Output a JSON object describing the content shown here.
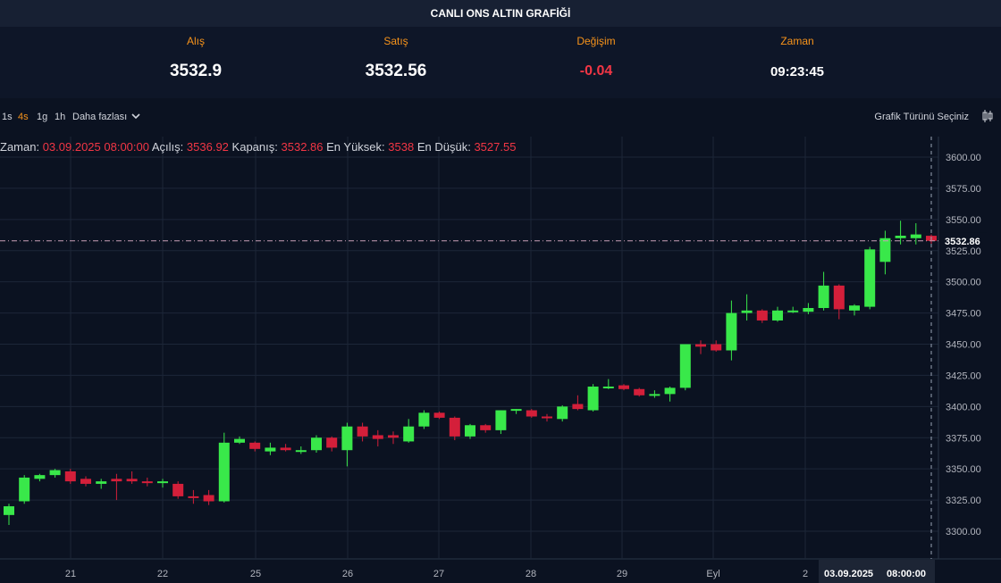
{
  "header": {
    "title": "CANLI ONS ALTIN GRAFİĞİ"
  },
  "quotes": {
    "bid_label": "Alış",
    "bid": "3532.9",
    "ask_label": "Satış",
    "ask": "3532.56",
    "change_label": "Değişim",
    "change": "-0.04",
    "time_label": "Zaman",
    "time": "09:23:45"
  },
  "toolbar": {
    "timeframes": [
      "1s",
      "4s",
      "1g",
      "1h"
    ],
    "active_timeframe": "4s",
    "more_label": "Daha fazlası",
    "chart_type_label": "Grafik Türünü Seçiniz"
  },
  "ohlc_legend": {
    "time_label": "Zaman:",
    "time": "03.09.2025 08:00:00",
    "open_label": "Açılış:",
    "open": "3536.92",
    "close_label": "Kapanış:",
    "close": "3532.86",
    "high_label": "En Yüksek:",
    "high": "3538",
    "low_label": "En Düşük:",
    "low": "3527.55"
  },
  "colors": {
    "up": "#39e84a",
    "down": "#d41f3a",
    "background": "#0b1221",
    "grid": "#1c2638",
    "accent": "#f7931a"
  },
  "chart_data": {
    "type": "candlestick",
    "ylim": [
      3275,
      3615
    ],
    "y_ticks": [
      3300,
      3325,
      3350,
      3375,
      3400,
      3425,
      3450,
      3475,
      3500,
      3525,
      3550,
      3575,
      3600
    ],
    "y_tick_labels": [
      "3300.00",
      "3325.00",
      "3350.00",
      "3375.00",
      "3400.00",
      "3425.00",
      "3450.00",
      "3475.00",
      "3500.00",
      "3525.00",
      "3550.00",
      "3575.00",
      "3600.00"
    ],
    "x_labels": [
      "21",
      "22",
      "25",
      "26",
      "27",
      "28",
      "29",
      "Eyl",
      "2"
    ],
    "last_price_label": "3532.86",
    "crosshair_date": "03.09.2025",
    "crosshair_time": "08:00:00",
    "candles": [
      {
        "o": 3313,
        "h": 3322,
        "l": 3305,
        "c": 3320
      },
      {
        "o": 3324,
        "h": 3345,
        "l": 3322,
        "c": 3343
      },
      {
        "o": 3342,
        "h": 3346,
        "l": 3340,
        "c": 3345
      },
      {
        "o": 3345,
        "h": 3350,
        "l": 3343,
        "c": 3349
      },
      {
        "o": 3348,
        "h": 3350,
        "l": 3338,
        "c": 3340
      },
      {
        "o": 3342,
        "h": 3344,
        "l": 3336,
        "c": 3338
      },
      {
        "o": 3338,
        "h": 3342,
        "l": 3334,
        "c": 3340
      },
      {
        "o": 3342,
        "h": 3346,
        "l": 3325,
        "c": 3340
      },
      {
        "o": 3342,
        "h": 3348,
        "l": 3338,
        "c": 3340
      },
      {
        "o": 3340,
        "h": 3343,
        "l": 3336,
        "c": 3339
      },
      {
        "o": 3339,
        "h": 3342,
        "l": 3335,
        "c": 3340
      },
      {
        "o": 3338,
        "h": 3340,
        "l": 3326,
        "c": 3328
      },
      {
        "o": 3328,
        "h": 3333,
        "l": 3322,
        "c": 3327
      },
      {
        "o": 3329,
        "h": 3333,
        "l": 3321,
        "c": 3324
      },
      {
        "o": 3324,
        "h": 3379,
        "l": 3323,
        "c": 3371
      },
      {
        "o": 3371,
        "h": 3376,
        "l": 3370,
        "c": 3374
      },
      {
        "o": 3371,
        "h": 3372,
        "l": 3364,
        "c": 3366
      },
      {
        "o": 3364,
        "h": 3371,
        "l": 3361,
        "c": 3367
      },
      {
        "o": 3367,
        "h": 3370,
        "l": 3364,
        "c": 3365
      },
      {
        "o": 3364,
        "h": 3368,
        "l": 3362,
        "c": 3365
      },
      {
        "o": 3365,
        "h": 3377,
        "l": 3363,
        "c": 3375
      },
      {
        "o": 3375,
        "h": 3376,
        "l": 3364,
        "c": 3367
      },
      {
        "o": 3365,
        "h": 3387,
        "l": 3352,
        "c": 3384
      },
      {
        "o": 3384,
        "h": 3387,
        "l": 3372,
        "c": 3376
      },
      {
        "o": 3377,
        "h": 3381,
        "l": 3368,
        "c": 3374
      },
      {
        "o": 3377,
        "h": 3380,
        "l": 3370,
        "c": 3375
      },
      {
        "o": 3372,
        "h": 3390,
        "l": 3371,
        "c": 3384
      },
      {
        "o": 3384,
        "h": 3397,
        "l": 3382,
        "c": 3395
      },
      {
        "o": 3395,
        "h": 3396,
        "l": 3390,
        "c": 3391
      },
      {
        "o": 3391,
        "h": 3392,
        "l": 3373,
        "c": 3376
      },
      {
        "o": 3376,
        "h": 3386,
        "l": 3374,
        "c": 3385
      },
      {
        "o": 3385,
        "h": 3386,
        "l": 3379,
        "c": 3381
      },
      {
        "o": 3381,
        "h": 3397,
        "l": 3378,
        "c": 3397
      },
      {
        "o": 3397,
        "h": 3398,
        "l": 3394,
        "c": 3398
      },
      {
        "o": 3397,
        "h": 3398,
        "l": 3391,
        "c": 3392
      },
      {
        "o": 3392,
        "h": 3394,
        "l": 3388,
        "c": 3391
      },
      {
        "o": 3390,
        "h": 3401,
        "l": 3388,
        "c": 3400
      },
      {
        "o": 3402,
        "h": 3409,
        "l": 3397,
        "c": 3398
      },
      {
        "o": 3397,
        "h": 3418,
        "l": 3396,
        "c": 3416
      },
      {
        "o": 3415,
        "h": 3422,
        "l": 3414,
        "c": 3416
      },
      {
        "o": 3417,
        "h": 3418,
        "l": 3413,
        "c": 3414
      },
      {
        "o": 3414,
        "h": 3415,
        "l": 3408,
        "c": 3409
      },
      {
        "o": 3409,
        "h": 3413,
        "l": 3407,
        "c": 3410
      },
      {
        "o": 3410,
        "h": 3416,
        "l": 3404,
        "c": 3415
      },
      {
        "o": 3415,
        "h": 3450,
        "l": 3413,
        "c": 3450
      },
      {
        "o": 3450,
        "h": 3453,
        "l": 3442,
        "c": 3448
      },
      {
        "o": 3450,
        "h": 3453,
        "l": 3444,
        "c": 3445
      },
      {
        "o": 3445,
        "h": 3485,
        "l": 3437,
        "c": 3475
      },
      {
        "o": 3475,
        "h": 3490,
        "l": 3469,
        "c": 3477
      },
      {
        "o": 3477,
        "h": 3478,
        "l": 3467,
        "c": 3469
      },
      {
        "o": 3469,
        "h": 3480,
        "l": 3468,
        "c": 3477
      },
      {
        "o": 3477,
        "h": 3480,
        "l": 3475,
        "c": 3477
      },
      {
        "o": 3476,
        "h": 3483,
        "l": 3474,
        "c": 3479
      },
      {
        "o": 3479,
        "h": 3508,
        "l": 3477,
        "c": 3497
      },
      {
        "o": 3497,
        "h": 3498,
        "l": 3470,
        "c": 3478
      },
      {
        "o": 3477,
        "h": 3482,
        "l": 3473,
        "c": 3481
      },
      {
        "o": 3480,
        "h": 3528,
        "l": 3478,
        "c": 3526
      },
      {
        "o": 3516,
        "h": 3541,
        "l": 3506,
        "c": 3535
      },
      {
        "o": 3535,
        "h": 3549,
        "l": 3530,
        "c": 3537
      },
      {
        "o": 3535,
        "h": 3547,
        "l": 3530,
        "c": 3538
      },
      {
        "o": 3536.92,
        "h": 3538,
        "l": 3527.55,
        "c": 3532.86
      }
    ]
  }
}
